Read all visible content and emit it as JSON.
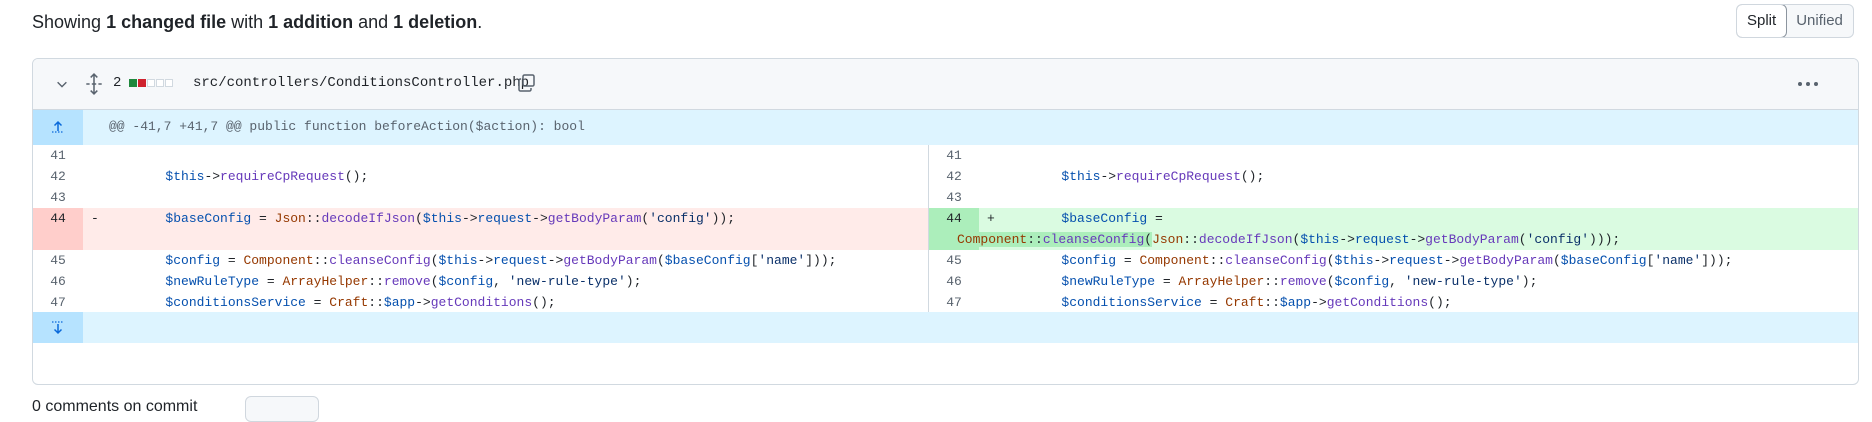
{
  "summary": {
    "prefix": "Showing ",
    "changed": "1 changed file",
    "with": " with ",
    "additions": "1 addition",
    "and": " and ",
    "deletions": "1 deletion",
    "suffix": "."
  },
  "view_toggle": {
    "split": "Split",
    "unified": "Unified",
    "selected": "Split"
  },
  "file": {
    "change_count": "2",
    "diffstat": [
      "add",
      "del",
      "neutral",
      "neutral",
      "neutral"
    ],
    "path": "src/controllers/ConditionsController.php",
    "icons": {
      "collapse": "chevron-down-icon",
      "expand": "unfold-icon",
      "copy": "copy-icon",
      "more": "kebab-horizontal-icon"
    }
  },
  "hunk": {
    "header": "@@ -41,7 +41,7 @@ public function beforeAction($action): bool"
  },
  "lines": {
    "l41": "41",
    "r41": "41",
    "l42": "42",
    "r42": "42",
    "l43": "43",
    "r43": "43",
    "l44": "44",
    "r44": "44",
    "l45": "45",
    "r45": "45",
    "l46": "46",
    "r46": "46",
    "l47": "47",
    "r47": "47",
    "minus": "-",
    "plus": "+"
  },
  "code": {
    "this": "$this",
    "arrow": "->",
    "requireCpRequest": "requireCpRequest",
    "parens_semi": "();",
    "baseConfig": "$baseConfig",
    "eq": " = ",
    "Json": "Json",
    "dcolon": "::",
    "decodeIfJson": "decodeIfJson",
    "open": "(",
    "request": "request",
    "getBodyParam": "getBodyParam",
    "config_str": "'config'",
    "close_del": "));",
    "close_add": ")));",
    "close_bracket": "]));",
    "Component": "Component",
    "cleanseConfig": "cleanseConfig",
    "config": "$config",
    "name_idx_open": "[",
    "name_str": "'name'",
    "newRuleType": "$newRuleType",
    "ArrayHelper": "ArrayHelper",
    "remove": "remove",
    "comma_sp": ", ",
    "rule_str": "'new-rule-type'",
    "close_semi": ");",
    "conditionsService": "$conditionsService",
    "Craft": "Craft",
    "app": "$app",
    "getConditions": "getConditions",
    "eq_add": " ="
  },
  "footer": {
    "comments_text": "0 comments on commit"
  },
  "colors": {
    "add_bg": "#dafbe1",
    "add_gutter": "#aceebb",
    "del_bg": "#ffebe9",
    "del_gutter": "#ffcecb",
    "hunk_bg": "#ddf4ff"
  }
}
